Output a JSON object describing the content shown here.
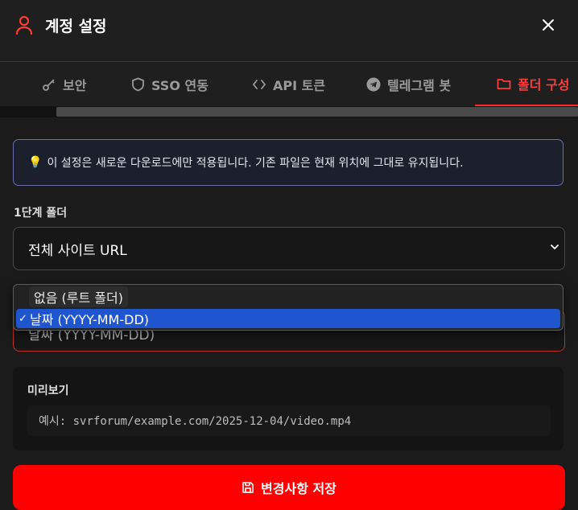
{
  "header": {
    "title": "계정 설정",
    "user_icon": "user-icon",
    "close_icon": "close-icon"
  },
  "tabs": [
    {
      "label": "보안",
      "icon": "key-icon"
    },
    {
      "label": "SSO 연동",
      "icon": "shield-icon"
    },
    {
      "label": "API 토큰",
      "icon": "code-icon"
    },
    {
      "label": "텔레그램 봇",
      "icon": "telegram-icon"
    },
    {
      "label": "폴더 구성",
      "icon": "folder-icon",
      "active": true
    }
  ],
  "info": {
    "icon": "lightbulb-icon",
    "text": "이 설정은 새로운 다운로드에만 적용됩니다. 기존 파일은 현재 위치에 그대로 유지됩니다."
  },
  "level1": {
    "label": "1단계 폴더",
    "selected": "전체 사이트 URL"
  },
  "level2": {
    "selected": "날짜 (YYYY-MM-DD)"
  },
  "dropdown": {
    "options": [
      {
        "label": "없음 (루트 폴더)"
      },
      {
        "label": "날짜 (YYYY-MM-DD)",
        "checkmark": "✓",
        "selected": true
      }
    ]
  },
  "preview": {
    "title": "미리보기",
    "example": "예시: svrforum/example.com/2025-12-04/video.mp4"
  },
  "save_button": {
    "label": "변경사항 저장",
    "icon": "save-icon"
  },
  "colors": {
    "accent": "#ff0000",
    "active_tab": "#ff3b3b",
    "selected_option": "#1f55cf"
  }
}
